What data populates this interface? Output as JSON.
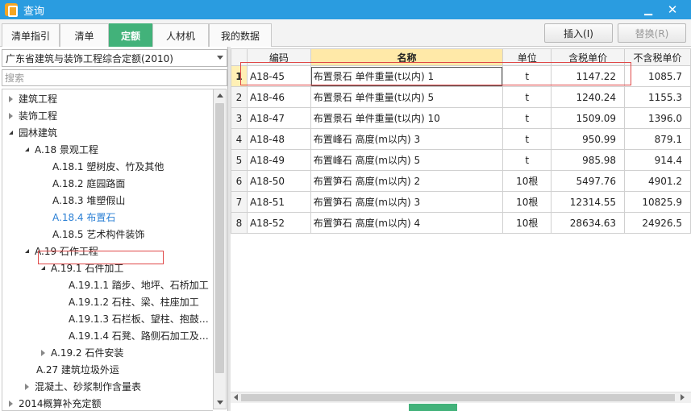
{
  "window": {
    "title": "查询",
    "minimize_glyph": "▁",
    "close_glyph": "✕"
  },
  "tabs": [
    {
      "label": "清单指引"
    },
    {
      "label": "清单"
    },
    {
      "label": "定额"
    },
    {
      "label": "人材机"
    },
    {
      "label": "我的数据"
    }
  ],
  "toolbar": {
    "insert_label": "插入(I)",
    "replace_label": "替换(R)"
  },
  "left_panel": {
    "library_select": "广东省建筑与装饰工程综合定额(2010)",
    "search_placeholder": "搜索",
    "tree": [
      {
        "label": "建筑工程"
      },
      {
        "label": "装饰工程"
      },
      {
        "label": "园林建筑"
      },
      {
        "label": "A.18 景观工程"
      },
      {
        "label": "A.18.1 塑树皮、竹及其他"
      },
      {
        "label": "A.18.2 庭园路面"
      },
      {
        "label": "A.18.3 堆塑假山"
      },
      {
        "label": "A.18.4 布置石"
      },
      {
        "label": "A.18.5 艺术构件装饰"
      },
      {
        "label": "A.19 石作工程"
      },
      {
        "label": "A.19.1 石件加工"
      },
      {
        "label": "A.19.1.1 踏步、地坪、石桥加工"
      },
      {
        "label": "A.19.1.2 石柱、梁、柱座加工"
      },
      {
        "label": "A.19.1.3 石栏板、望柱、抱鼓…"
      },
      {
        "label": "A.19.1.4 石凳、路侧石加工及…"
      },
      {
        "label": "A.19.2 石件安装"
      },
      {
        "label": "A.27 建筑垃圾外运"
      },
      {
        "label": "混凝土、砂浆制作含量表"
      },
      {
        "label": "2014概算补充定额"
      }
    ]
  },
  "grid": {
    "columns": [
      "编码",
      "名称",
      "单位",
      "含税单价",
      "不含税单价"
    ],
    "rows": [
      {
        "num": "1",
        "code": "A18-45",
        "name": "布置景石 单件重量(t以内) 1",
        "unit": "t",
        "tax_price": "1147.22",
        "notax_price": "1085.7"
      },
      {
        "num": "2",
        "code": "A18-46",
        "name": "布置景石 单件重量(t以内) 5",
        "unit": "t",
        "tax_price": "1240.24",
        "notax_price": "1155.3"
      },
      {
        "num": "3",
        "code": "A18-47",
        "name": "布置景石 单件重量(t以内) 10",
        "unit": "t",
        "tax_price": "1509.09",
        "notax_price": "1396.0"
      },
      {
        "num": "4",
        "code": "A18-48",
        "name": "布置峰石 高度(m以内) 3",
        "unit": "t",
        "tax_price": "950.99",
        "notax_price": "879.1"
      },
      {
        "num": "5",
        "code": "A18-49",
        "name": "布置峰石 高度(m以内) 5",
        "unit": "t",
        "tax_price": "985.98",
        "notax_price": "914.4"
      },
      {
        "num": "6",
        "code": "A18-50",
        "name": "布置笋石 高度(m以内) 2",
        "unit": "10根",
        "tax_price": "5497.76",
        "notax_price": "4901.2"
      },
      {
        "num": "7",
        "code": "A18-51",
        "name": "布置笋石 高度(m以内) 3",
        "unit": "10根",
        "tax_price": "12314.55",
        "notax_price": "10825.9"
      },
      {
        "num": "8",
        "code": "A18-52",
        "name": "布置笋石 高度(m以内) 4",
        "unit": "10根",
        "tax_price": "28634.63",
        "notax_price": "24926.5"
      }
    ]
  }
}
